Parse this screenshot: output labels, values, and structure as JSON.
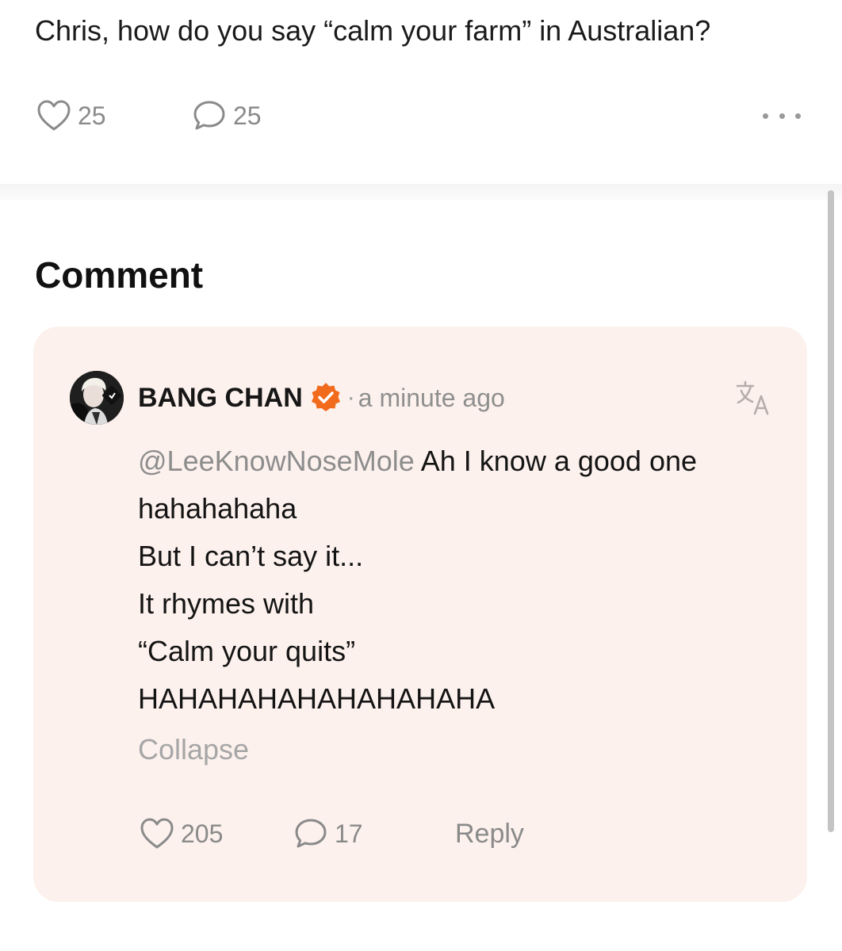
{
  "post": {
    "text": "Chris, how do you say “calm your farm” in Australian?",
    "likes": "25",
    "comments": "25"
  },
  "comments_section": {
    "title": "Comment"
  },
  "comment": {
    "author": "BANG CHAN",
    "separator": "·",
    "time": "a minute ago",
    "mention": "@LeeKnowNoseMole",
    "text_first": " Ah I know a good one",
    "lines": [
      "hahahahaha",
      "But I can’t say it...",
      "It rhymes with",
      "“Calm your quits”",
      "HAHAHAHAHAHAHAHAHA"
    ],
    "collapse_label": "Collapse",
    "likes": "205",
    "replies": "17",
    "reply_label": "Reply"
  },
  "colors": {
    "card_background": "#fcf1ed",
    "verified_badge": "#f26a1b",
    "muted_text": "#8a8a8a"
  },
  "icons": {
    "like": "heart-outline-icon",
    "comment": "speech-bubble-outline-icon",
    "more": "ellipsis-icon",
    "verified": "verified-badge-icon",
    "translate": "translate-icon"
  }
}
